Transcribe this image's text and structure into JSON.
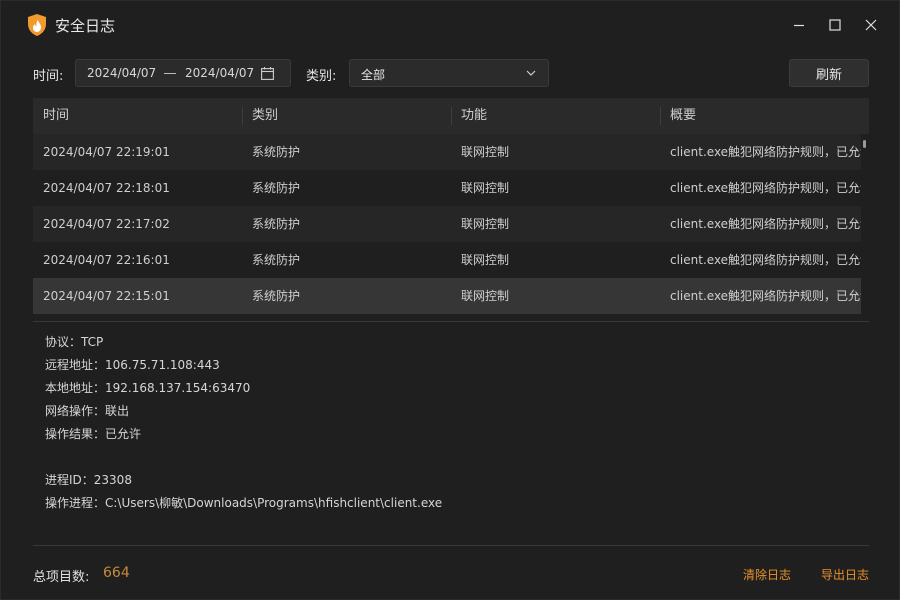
{
  "window": {
    "title": "安全日志",
    "accent_color": "#f29a2e",
    "link_color": "#e8912a",
    "count_color": "#c8893c",
    "controls": [
      "minimize-icon",
      "maximize-icon",
      "close-icon"
    ]
  },
  "filters": {
    "time_label": "时间:",
    "date_start": "2024/04/07",
    "date_end": "2024/04/07",
    "calendar_icon": "calendar-icon",
    "category_label": "类别:",
    "category_value": "全部",
    "refresh_label": "刷新"
  },
  "table": {
    "columns": [
      "时间",
      "类别",
      "功能",
      "概要"
    ],
    "rows": [
      {
        "time": "2024/04/07 22:19:01",
        "category": "系统防护",
        "function": "联网控制",
        "summary": "client.exe触犯网络防护规则，已允许"
      },
      {
        "time": "2024/04/07 22:18:01",
        "category": "系统防护",
        "function": "联网控制",
        "summary": "client.exe触犯网络防护规则，已允许"
      },
      {
        "time": "2024/04/07 22:17:02",
        "category": "系统防护",
        "function": "联网控制",
        "summary": "client.exe触犯网络防护规则，已允许"
      },
      {
        "time": "2024/04/07 22:16:01",
        "category": "系统防护",
        "function": "联网控制",
        "summary": "client.exe触犯网络防护规则，已允许"
      },
      {
        "time": "2024/04/07 22:15:01",
        "category": "系统防护",
        "function": "联网控制",
        "summary": "client.exe触犯网络防护规则，已允许"
      }
    ],
    "selected_row_index": 4
  },
  "details": {
    "protocol": "协议：TCP",
    "remote_address": "远程地址：106.75.71.108:443",
    "local_address": "本地地址：192.168.137.154:63470",
    "network_action": "网络操作：联出",
    "action_result": "操作结果：已允许",
    "process_id": "进程ID：23308",
    "process_path": "操作进程：C:\\Users\\柳敏\\Downloads\\Programs\\hfishclient\\client.exe"
  },
  "footer": {
    "total_label": "总项目数:",
    "total_value": "664",
    "clear_label": "清除日志",
    "export_label": "导出日志"
  }
}
